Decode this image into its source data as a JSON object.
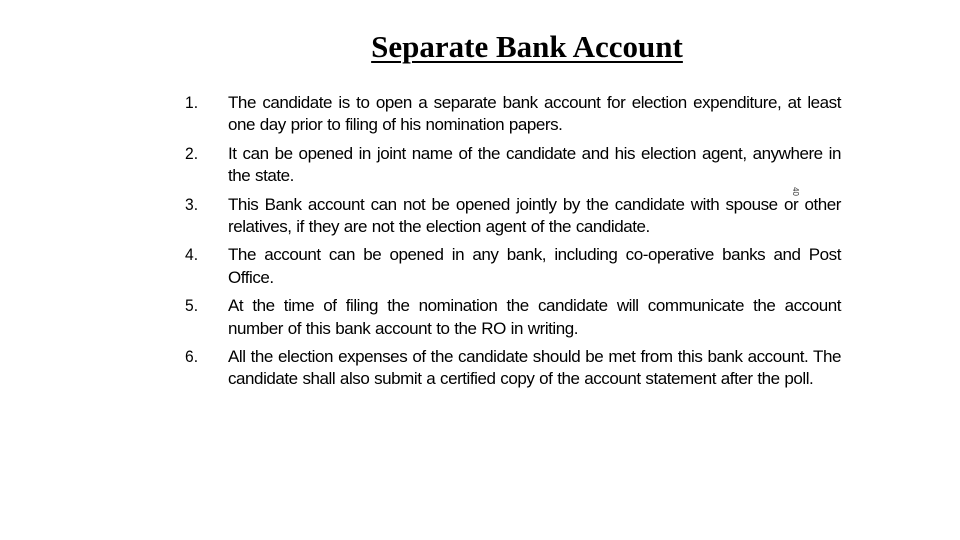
{
  "slide": {
    "title": "Separate Bank Account",
    "page_mark": "40",
    "items": [
      {
        "number": "1.",
        "text": "The candidate is to open a separate bank account for election expenditure, at least one day prior to filing of his nomination papers."
      },
      {
        "number": "2.",
        "text": "It can be opened in joint name of the candidate and his election agent, anywhere in the state."
      },
      {
        "number": "3.",
        "text": "This Bank account can not be opened jointly by the candidate with spouse or other relatives, if they are not the election agent of the candidate."
      },
      {
        "number": "4.",
        "text": "The account can be opened in any bank, including co-operative banks and Post Office."
      },
      {
        "number": "5.",
        "text": "At the time of filing the nomination the candidate will communicate the account number of this bank account to the RO in writing."
      },
      {
        "number": "6.",
        "text": "All the election expenses of the candidate should be met from this bank account. The candidate shall also submit a certified copy of the account statement after the poll."
      }
    ]
  }
}
